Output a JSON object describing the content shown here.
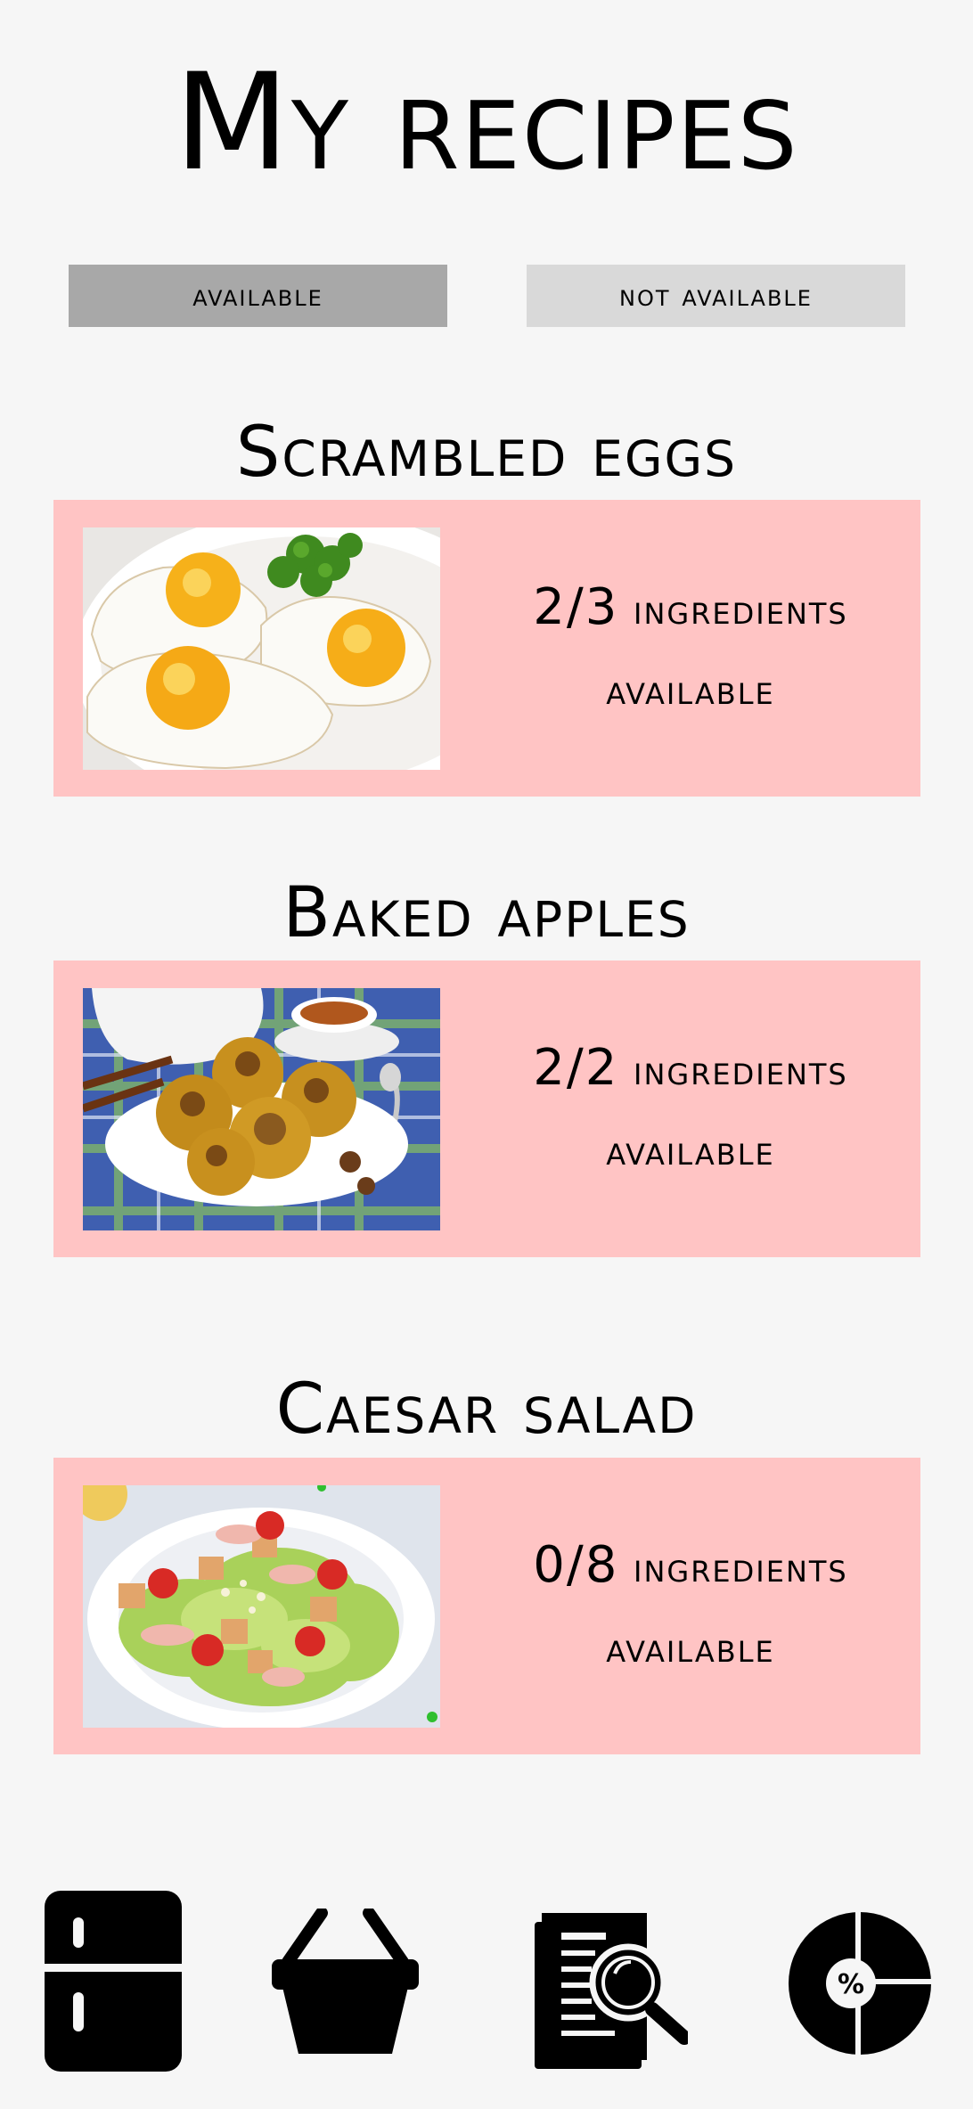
{
  "header": {
    "title": "My recipes"
  },
  "filters": {
    "available_label": "available",
    "not_available_label": "not available"
  },
  "recipes": [
    {
      "name": "Scrambled eggs",
      "ratio": "2/3",
      "ingredients_word": "ingredients",
      "status": "available"
    },
    {
      "name": "Baked apples",
      "ratio": "2/2",
      "ingredients_word": "ingredients",
      "status": "available"
    },
    {
      "name": "Caesar salad",
      "ratio": "0/8",
      "ingredients_word": "ingredients",
      "status": "available"
    }
  ],
  "bottom_nav": {
    "items": [
      {
        "icon": "fridge-icon"
      },
      {
        "icon": "basket-icon"
      },
      {
        "icon": "recipe-search-icon"
      },
      {
        "icon": "discount-pie-icon",
        "symbol": "%"
      }
    ]
  },
  "colors": {
    "background": "#f6f6f6",
    "card": "#ffc4c4",
    "filter_active": "#a8a8a8",
    "filter_inactive": "#d9d9d9"
  }
}
